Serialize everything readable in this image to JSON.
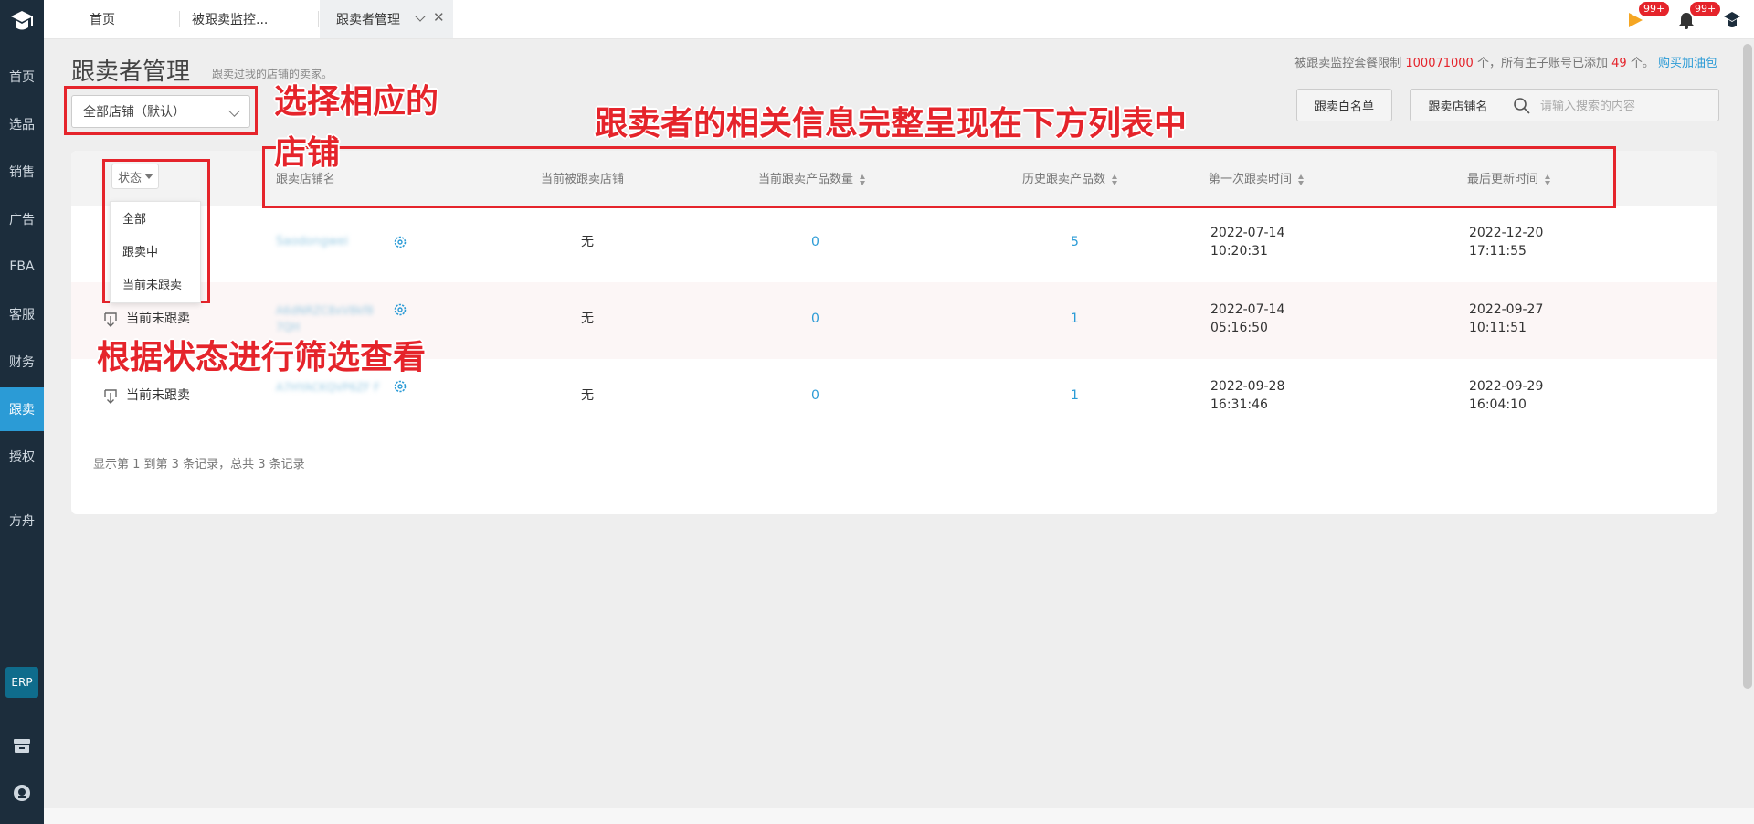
{
  "sidebar": {
    "items": [
      {
        "label": "首页"
      },
      {
        "label": "选品"
      },
      {
        "label": "销售"
      },
      {
        "label": "广告"
      },
      {
        "label": "FBA"
      },
      {
        "label": "客服"
      },
      {
        "label": "财务"
      },
      {
        "label": "跟卖"
      },
      {
        "label": "授权"
      },
      {
        "label": "方舟"
      }
    ],
    "active": "跟卖",
    "erp_label": "ERP"
  },
  "tabs": [
    {
      "label": "首页"
    },
    {
      "label": "被跟卖监控..."
    },
    {
      "label": "跟卖者管理",
      "active": true
    }
  ],
  "header": {
    "flag_badge": "99+",
    "bell_badge": "99+"
  },
  "page": {
    "title": "跟卖者管理",
    "subtitle": "跟卖过我的店铺的卖家。",
    "quota_prefix": "被跟卖监控套餐限制",
    "quota_limit": "100071000",
    "quota_mid": "个，所有主子账号已添加",
    "quota_added": "49",
    "quota_suffix": "个。",
    "buy_link": "购买加油包",
    "shop_select": "全部店铺（默认）",
    "whitelist_button": "跟卖白名单",
    "search_field_button": "跟卖店铺名",
    "search_placeholder": "请输入搜索的内容"
  },
  "table": {
    "status_filter": "状态",
    "status_options": [
      "全部",
      "跟卖中",
      "当前未跟卖"
    ],
    "columns": [
      "跟卖店铺名",
      "当前被跟卖店铺",
      "当前跟卖产品数量",
      "历史跟卖产品数",
      "第一次跟卖时间",
      "最后更新时间"
    ],
    "rows": [
      {
        "status": "",
        "shop": "Saodongwei",
        "current_store": "无",
        "current_count": "0",
        "history_count": "5",
        "first_date": "2022-07-14",
        "first_time": "10:20:31",
        "last_date": "2022-12-20",
        "last_time": "17:11:55"
      },
      {
        "status": "当前未跟卖",
        "shop": "A6dNRZC8xV8kf8 7QH",
        "current_store": "无",
        "current_count": "0",
        "history_count": "1",
        "first_date": "2022-07-14",
        "first_time": "05:16:50",
        "last_date": "2022-09-27",
        "last_time": "10:11:51"
      },
      {
        "status": "当前未跟卖",
        "shop": "A7HYACKQVP6ZF F",
        "current_store": "无",
        "current_count": "0",
        "history_count": "1",
        "first_date": "2022-09-28",
        "first_time": "16:31:46",
        "last_date": "2022-09-29",
        "last_time": "16:04:10"
      }
    ],
    "pager": "显示第 1 到第 3 条记录，总共 3 条记录"
  },
  "annotations": {
    "select_shop_line1": "选择相应的",
    "select_shop_line2": "店铺",
    "list_info": "跟卖者的相关信息完整呈现在下方列表中",
    "status_filter": "根据状态进行筛选查看"
  },
  "colors": {
    "sidebar_bg": "#1c2d3c",
    "accent": "#2b9bd6",
    "annotation_red": "#e5242b"
  }
}
